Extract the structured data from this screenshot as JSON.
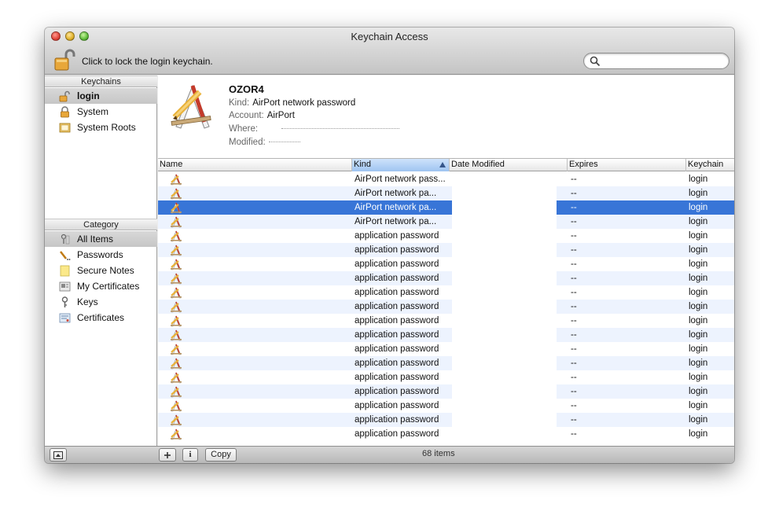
{
  "window": {
    "title": "Keychain Access"
  },
  "toolbar": {
    "lock_text": "Click to lock the login keychain.",
    "search_placeholder": ""
  },
  "sidebar": {
    "keychains_header": "Keychains",
    "keychains": [
      {
        "label": "login",
        "icon": "open-lock-icon",
        "selected": true
      },
      {
        "label": "System",
        "icon": "lock-icon",
        "selected": false
      },
      {
        "label": "System Roots",
        "icon": "certificate-folder-icon",
        "selected": false
      }
    ],
    "category_header": "Category",
    "categories": [
      {
        "label": "All Items",
        "icon": "all-items-icon",
        "selected": true
      },
      {
        "label": "Passwords",
        "icon": "pen-icon",
        "selected": false
      },
      {
        "label": "Secure Notes",
        "icon": "note-icon",
        "selected": false
      },
      {
        "label": "My Certificates",
        "icon": "my-certificates-icon",
        "selected": false
      },
      {
        "label": "Keys",
        "icon": "key-icon",
        "selected": false
      },
      {
        "label": "Certificates",
        "icon": "certificate-icon",
        "selected": false
      }
    ]
  },
  "detail": {
    "name": "OZOR4",
    "kind_label": "Kind:",
    "kind_value": "AirPort network password",
    "account_label": "Account:",
    "account_value": "AirPort",
    "where_label": "Where:",
    "modified_label": "Modified:"
  },
  "table": {
    "columns": {
      "name": "Name",
      "kind": "Kind",
      "date_modified": "Date Modified",
      "expires": "Expires",
      "keychain": "Keychain"
    },
    "rows": [
      {
        "kind": "AirPort network pass...",
        "expires": "--",
        "keychain": "login"
      },
      {
        "kind": "AirPort network pa...",
        "expires": "--",
        "keychain": "login"
      },
      {
        "kind": "AirPort network pa...",
        "expires": "--",
        "keychain": "login"
      },
      {
        "kind": "AirPort network pa...",
        "expires": "--",
        "keychain": "login"
      },
      {
        "kind": "application password",
        "expires": "--",
        "keychain": "login"
      },
      {
        "kind": "application password",
        "expires": "--",
        "keychain": "login"
      },
      {
        "kind": "application password",
        "expires": "--",
        "keychain": "login"
      },
      {
        "kind": "application password",
        "expires": "--",
        "keychain": "login"
      },
      {
        "kind": "application password",
        "expires": "--",
        "keychain": "login"
      },
      {
        "kind": "application password",
        "expires": "--",
        "keychain": "login"
      },
      {
        "kind": "application password",
        "expires": "--",
        "keychain": "login"
      },
      {
        "kind": "application password",
        "expires": "--",
        "keychain": "login"
      },
      {
        "kind": "application password",
        "expires": "--",
        "keychain": "login"
      },
      {
        "kind": "application password",
        "expires": "--",
        "keychain": "login"
      },
      {
        "kind": "application password",
        "expires": "--",
        "keychain": "login"
      },
      {
        "kind": "application password",
        "expires": "--",
        "keychain": "login"
      },
      {
        "kind": "application password",
        "expires": "--",
        "keychain": "login"
      },
      {
        "kind": "application password",
        "expires": "--",
        "keychain": "login"
      },
      {
        "kind": "application password",
        "expires": "--",
        "keychain": "login"
      }
    ],
    "selected_row": 2
  },
  "bottom": {
    "copy_label": "Copy",
    "info_label": "i",
    "item_count": "68 items"
  }
}
